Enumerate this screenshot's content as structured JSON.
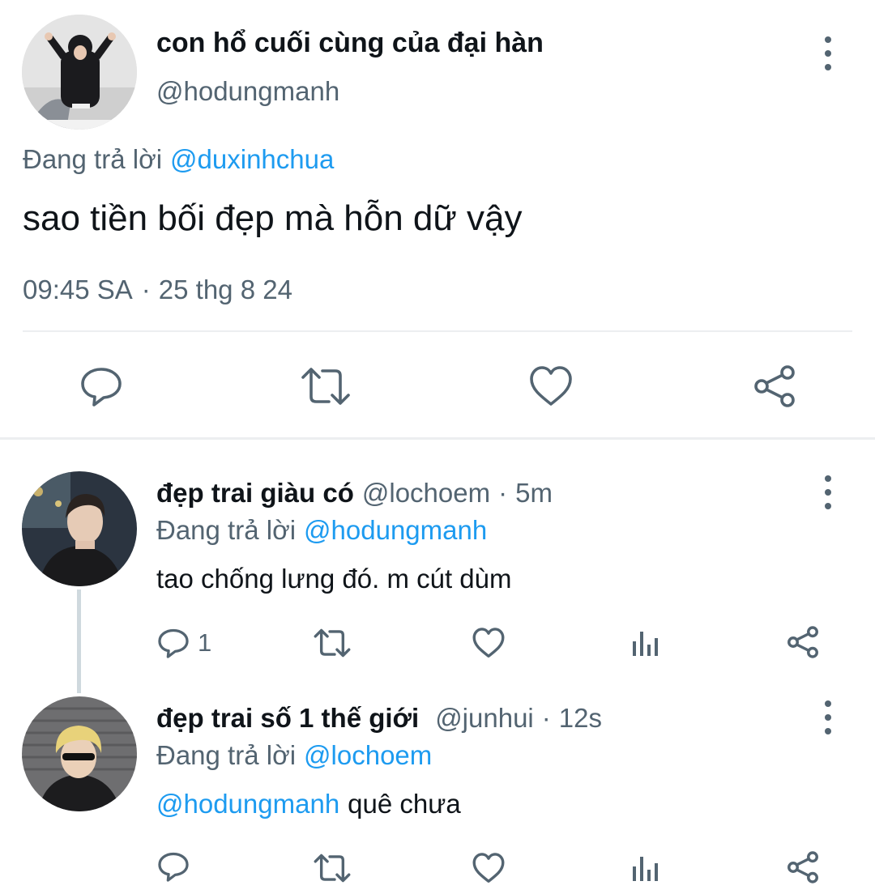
{
  "main_tweet": {
    "display_name": "con hổ cuối cùng của đại hàn",
    "handle": "@hodungmanh",
    "replying_prefix": "Đang trả lời",
    "replying_to": "@duxinhchua",
    "text": "sao tiền bối đẹp mà hỗn dữ vậy",
    "time": "09:45 SA",
    "date_sep": "·",
    "date": "25 thg 8 24"
  },
  "replies": [
    {
      "display_name": "đẹp trai giàu có",
      "handle": "@lochoem",
      "sep": "·",
      "age": "5m",
      "replying_prefix": "Đang trả lời",
      "replying_to": "@hodungmanh",
      "text": "tao chống lưng đó. m cút dùm",
      "reply_count": "1"
    },
    {
      "display_name": "đẹp trai số 1 thế giới",
      "handle": "@junhui",
      "sep": "·",
      "age": "12s",
      "replying_prefix": "Đang trả lời",
      "replying_to": "@lochoem",
      "mention": "@hodungmanh",
      "text": "quê chưa"
    }
  ],
  "icons": {
    "main_actions": [
      "reply-icon",
      "retweet-icon",
      "like-icon",
      "share-icon"
    ],
    "reply_actions": [
      "reply-icon",
      "retweet-icon",
      "like-icon",
      "analytics-icon",
      "share-icon"
    ],
    "more": "more-vertical-icon"
  },
  "colors": {
    "text": "#0f1419",
    "muted": "#536471",
    "link": "#1d9bf0",
    "divider": "#e6e9ec"
  }
}
